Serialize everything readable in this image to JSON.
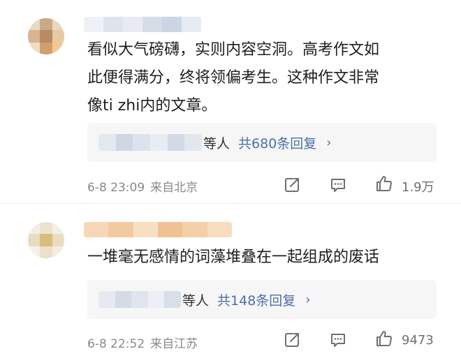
{
  "comments": [
    {
      "text_lines": [
        "看似大气磅礴，实则内容空洞。高考作文如",
        "此便得满分，终将领偏考生。这种作文非常",
        "像ti zhi内的文章。"
      ],
      "replies": {
        "suffix": "等人",
        "count_label": "共680条回复",
        "chevron": "›"
      },
      "time": "6-8 23:09",
      "location": "来自北京",
      "likes": "1.9万",
      "icons": [
        "share-icon",
        "comment-icon",
        "like-icon"
      ]
    },
    {
      "text_lines": [
        "一堆毫无感情的词藻堆叠在一起组成的废话"
      ],
      "replies": {
        "suffix": "等人",
        "count_label": "共148条回复",
        "chevron": "›"
      },
      "time": "6-8 22:52",
      "location": "来自江苏",
      "likes": "9473",
      "icons": [
        "share-icon",
        "comment-icon",
        "like-icon"
      ]
    }
  ],
  "colors": {
    "link_blue": "#4c6fa8",
    "meta_gray": "#8a8a8a",
    "reply_bg": "#f6f6f6"
  }
}
